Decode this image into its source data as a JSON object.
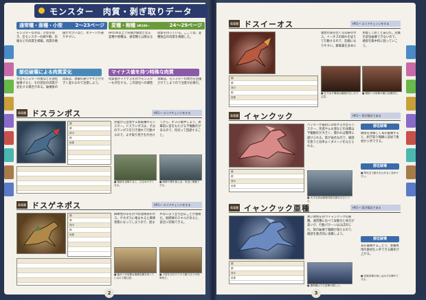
{
  "title": "モンスター　肉質・剥ぎ取りデータ",
  "section_intro": {
    "heading_low_rank": "通常種・亜種・小型",
    "low_rank_pages": "2〜23ページ",
    "heading_variants": "変種・剛種",
    "variant_range": "HR100〜",
    "variant_pages": "24〜29ページ",
    "box1_title": "部位破壊による肉質変化",
    "box2_title": "マイナス値を持つ特殊な肉質",
    "text_a": "モンスター以外は、小型を除き、全モンスターの頭や胴、尻尾などの肉質を掲載。肉質の数値が大きいほど、ダメージが通りやすい。",
    "text_b": "HR100以上で狩猟が解禁となる変種や剛種は、通常種とは異なる肉質を持っている。ここでは、変種独自の肉質を掲載した。",
    "text_c": "大型モンスターの角などを部位破壊すると、その部位の肉質が変化する場合がある。破壊後の肉質は、攻撃の通りやすさが大きく変わるので注意しよう。",
    "text_d": "肉質値がマイナスを持つモンスターも存在する。この部位への属性攻撃は、モンスターの体力を回復させてしまうので注意が必要だ。"
  },
  "monsters": [
    {
      "category": "鳥竜種",
      "name": "ドスランポス",
      "tag": "HR1〜 エリアチェンジをする",
      "text": "序盤から出現する鳥竜種のモンスター。ドスランポスは、子分のランポスを引き連れて行動するので、まず取り巻きを片付けてから、ボスに集中しよう。攻撃前に首をもたげる予備動作があるので、見切って回避すること。",
      "caption1": "■ 頭部を攻撃すると、ひるみやすくなる。",
      "caption2": "■ 麻痺や罠を使えば、安全に捕獲できる。"
    },
    {
      "category": "鳥竜種",
      "name": "ドスゲネポス",
      "tag": "HR1〜 エリアチェンジをする",
      "text": "麻痺性の牙を持つ砂漠地帯のボス。ゲネポスに噛まれると麻痺状態になってしまうので、囲まれないよう立ち回ることが重要だ。耐麻痺のスキルがあると、安全に狩猟できる。",
      "caption1": "■ 噛みつき攻撃は麻痺効果を持っているので要注意。",
      "caption2": "■ 小型を片付けてから戦うほうが効率的だ。"
    },
    {
      "category": "鳥竜種",
      "name": "ドスイーオス",
      "tag": "HR1〜 エリアチェンジをする",
      "text": "毒性の液を吐く火山帯のボス。イーオスの群れを従えて行動するので、乱戦になりやすい。解毒薬を多めに用意しておくと安心だ。尻尾を部位破壊できないので、頭部を集中的に狙っていこう。",
      "caption1": "■ 吐き出す毒液は範囲が広いので注意。",
      "caption2": "■ 頭部への攻撃が最も効果的だ。"
    },
    {
      "category": "鳥竜種",
      "name": "イャンクック",
      "tag": "HR1〜 耳が弱点である",
      "text": "ハンターが最初に対峙する大型モンスター。突進や火炎液などの攻撃は予備動作が大きく、慣れれば簡単に避けられる。耳が弱点なので、頭部を狙うと効率よくダメージを与えられる。",
      "caption1": "■ 大きな耳は破壊可能な部位のひとつだ。",
      "caption2": "■ 閃光玉で動きを止めると攻めやすい。",
      "notes_title": "部位破壊",
      "notes_text": "頭部を攻撃して耳を破壊すると、剥ぎ取り報酬に追加で素材が入手できる。"
    },
    {
      "category": "鳥竜種",
      "name": "イャンクック亜種",
      "tag": "HR1〜 耳が弱点である",
      "text": "青い体色を持つイャンクックの亜種。通常種に比べて攻撃力と体力が高いが、行動パターンはほぼ同じだ。耳の破壊で報酬が増えるので、頭部を重点的に攻撃しよう。",
      "caption1": "■ 通常種よりも攻撃が激しい。",
      "caption2": "■ 突進攻撃の後には大きな隙ができる。",
      "notes_title": "部位破壊",
      "notes_text": "耳を破壊することで、亜種専用の素材を入手できる確率が上がる。"
    }
  ],
  "stat_rows": [
    "頭",
    "胴",
    "背中",
    "脚",
    "尻尾"
  ],
  "page_left": "2",
  "page_right": "3",
  "colors": {
    "navy": "#2a3a6c",
    "accent_green": "#6a9a3a",
    "accent_blue": "#3a6aa8",
    "accent_purple": "#8a5aa8",
    "tab_colors": [
      "#4a8ac8",
      "#c86aa8",
      "#6ab84a",
      "#c8a03a",
      "#8a6ac8",
      "#c8504a",
      "#4ab8b0",
      "#a87a4a",
      "#5a7ac8"
    ]
  }
}
